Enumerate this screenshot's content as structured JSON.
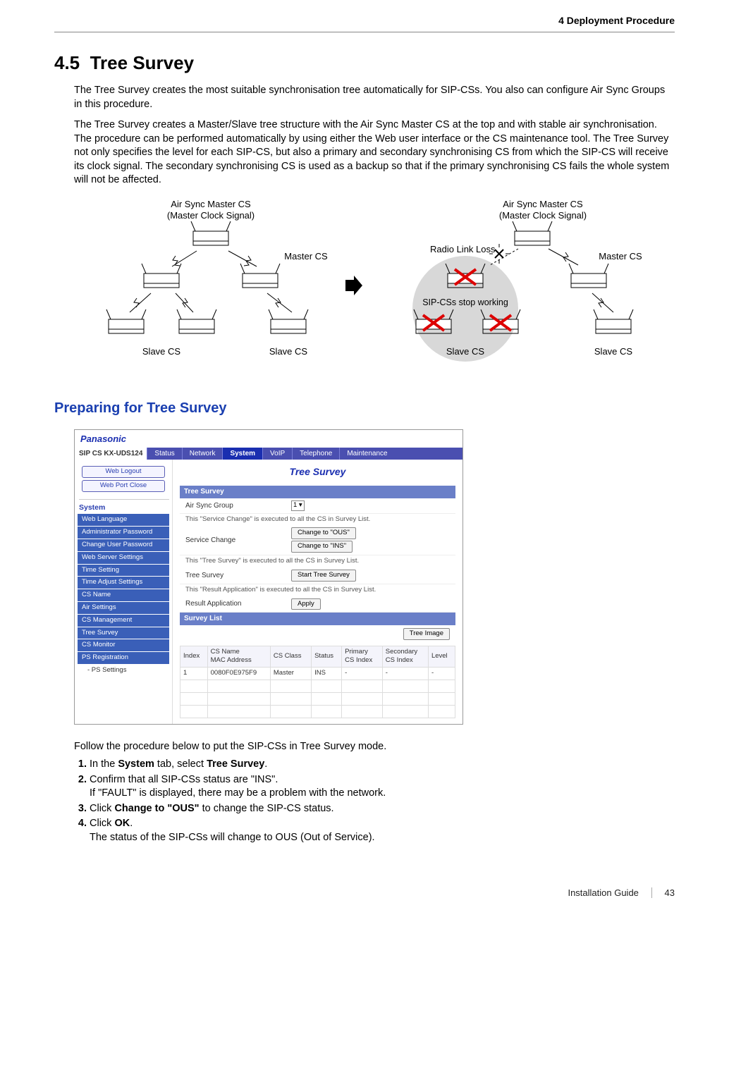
{
  "header": {
    "chapter": "4 Deployment Procedure"
  },
  "section": {
    "number": "4.5",
    "title": "Tree Survey",
    "para1": "The Tree Survey creates the most suitable synchronisation tree automatically for SIP-CSs. You also can configure Air Sync Groups in this procedure.",
    "para2": "The Tree Survey creates a Master/Slave tree structure with the Air Sync Master CS at the top and with stable air synchronisation. The procedure can be performed automatically by using either the Web user interface or the CS maintenance tool. The Tree Survey not only specifies the level for each SIP-CS, but also a primary and secondary synchronising CS from which the SIP-CS will receive its clock signal. The secondary synchronising CS is used as a backup so that if the primary synchronising CS fails the whole system will not be affected."
  },
  "diagram_labels": {
    "air_sync_master": "Air Sync Master CS",
    "master_clock": "(Master Clock Signal)",
    "master_cs": "Master CS",
    "slave_cs": "Slave CS",
    "radio_link_loss": "Radio Link Loss",
    "sip_stop": "SIP-CSs stop working"
  },
  "subsection": {
    "title": "Preparing for Tree Survey"
  },
  "screenshot": {
    "brand": "Panasonic",
    "model": "SIP CS KX-UDS124",
    "tabs": [
      "Status",
      "Network",
      "System",
      "VoIP",
      "Telephone",
      "Maintenance"
    ],
    "active_tab": "System",
    "side_buttons": [
      "Web Logout",
      "Web Port Close"
    ],
    "side_section": "System",
    "side_items": [
      "Web Language",
      "Administrator Password",
      "Change User Password",
      "Web Server Settings",
      "Time Setting",
      "Time Adjust Settings",
      "CS Name",
      "Air Settings",
      "CS Management",
      "Tree Survey",
      "CS Monitor",
      "PS Registration"
    ],
    "side_sub": "- PS Settings",
    "page_title": "Tree Survey",
    "tree_survey_bar": "Tree Survey",
    "air_sync_group_lbl": "Air Sync Group",
    "air_sync_group_val": "1",
    "note_service_change": "This \"Service Change\" is executed to all the CS in Survey List.",
    "service_change_lbl": "Service Change",
    "btn_change_ous": "Change to \"OUS\"",
    "btn_change_ins": "Change to \"INS\"",
    "note_tree_survey": "This \"Tree Survey\" is executed to all the CS in Survey List.",
    "tree_survey_lbl": "Tree Survey",
    "btn_start_tree": "Start Tree Survey",
    "note_result_app": "This \"Result Application\" is executed to all the CS in Survey List.",
    "result_app_lbl": "Result Application",
    "btn_apply": "Apply",
    "survey_list_bar": "Survey List",
    "btn_tree_image": "Tree Image",
    "table_headers": [
      "Index",
      "CS Name\nMAC Address",
      "CS Class",
      "Status",
      "Primary\nCS Index",
      "Secondary\nCS Index",
      "Level"
    ],
    "table_row": [
      "1",
      "0080F0E975F9",
      "Master",
      "INS",
      "-",
      "-",
      "-"
    ]
  },
  "procedure": {
    "intro": "Follow the procedure below to put the SIP-CSs in Tree Survey mode.",
    "steps": [
      "In the <b>System</b> tab, select <b>Tree Survey</b>.",
      "Confirm that all SIP-CSs status are \"INS\".<br>If \"FAULT\" is displayed, there may be a problem with the network.",
      "Click <b>Change to \"OUS\"</b> to change the SIP-CS status.",
      "Click <b>OK</b>.<br>The status of the SIP-CSs will change to OUS (Out of Service)."
    ]
  },
  "footer": {
    "guide": "Installation Guide",
    "page": "43"
  }
}
